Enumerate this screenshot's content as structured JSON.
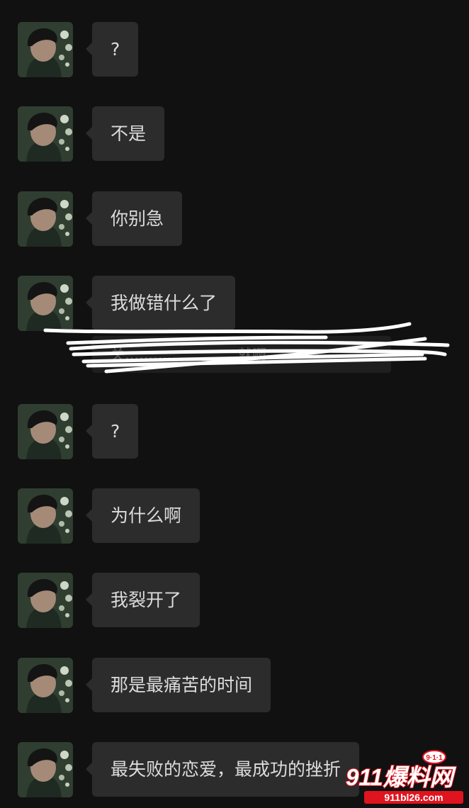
{
  "messages": [
    {
      "text": "?"
    },
    {
      "text": "不是"
    },
    {
      "text": "你别急"
    },
    {
      "text": "我做错什么了"
    },
    {
      "text": "?"
    },
    {
      "text": "为什么啊"
    },
    {
      "text": "我裂开了"
    },
    {
      "text": "那是最痛苦的时间"
    },
    {
      "text": "最失败的恋爱，最成功的挫折"
    }
  ],
  "quoted_message": {
    "text": "关……………………就啊"
  },
  "watermark": {
    "brand": "911爆料网",
    "badge": "9·1·1",
    "url": "911bl26.com"
  },
  "colors": {
    "background": "#111111",
    "bubble": "#2c2c2c",
    "bubble_text": "#dcdcdc",
    "scribble": "#ffffff",
    "watermark_red": "#e0141e"
  }
}
